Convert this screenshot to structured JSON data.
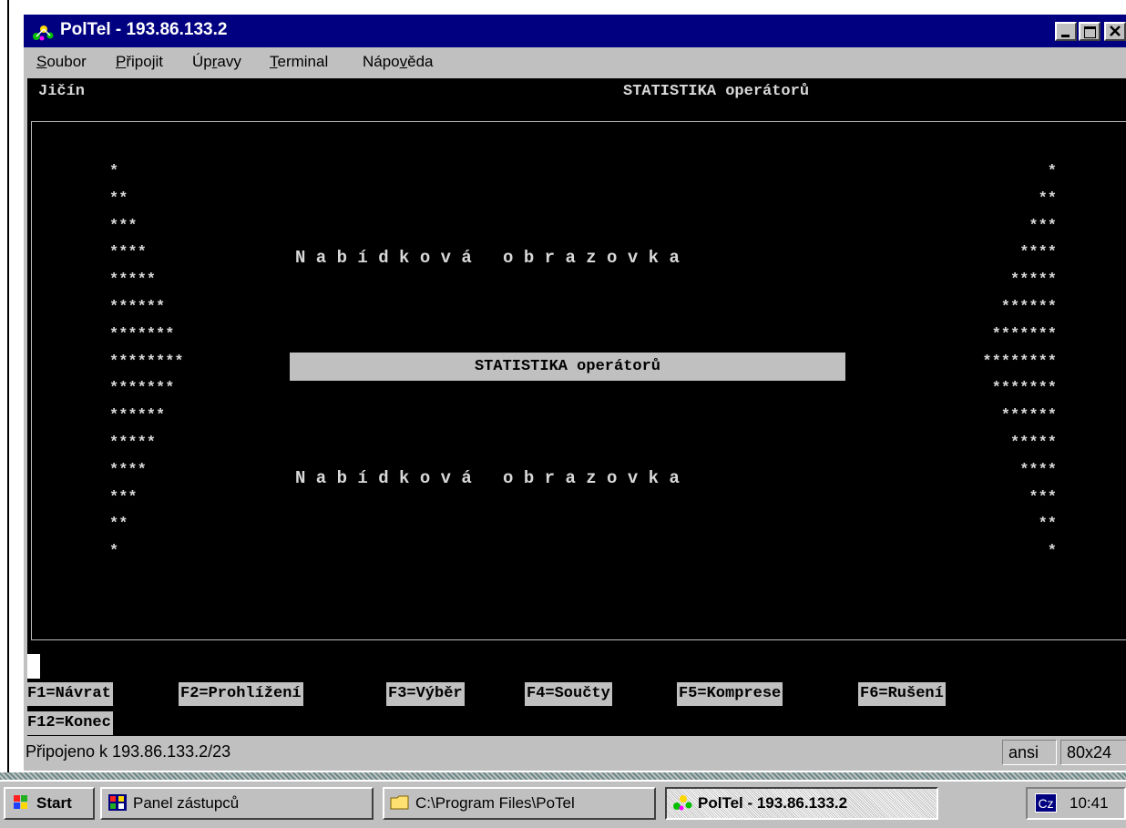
{
  "window": {
    "title": "PolTel - 193.86.133.2"
  },
  "menu": {
    "items": [
      {
        "pre": "",
        "ul": "S",
        "post": "oubor"
      },
      {
        "pre": "",
        "ul": "P",
        "post": "řipojit"
      },
      {
        "pre": "Úp",
        "ul": "r",
        "post": "avy"
      },
      {
        "pre": "",
        "ul": "T",
        "post": "erminal"
      },
      {
        "pre": "Nápo",
        "ul": "v",
        "post": "ěda"
      }
    ]
  },
  "terminal": {
    "location": "Jičín",
    "screen_title": "STATISTIKA operátorů",
    "menu_heading": "N a b í d k o v á   o b r a z o v k a",
    "selected_item": "STATISTIKA operátorů",
    "stars": [
      "*",
      "**",
      "***",
      "****",
      "*****",
      "******",
      "*******",
      "********",
      "*******",
      "******",
      "*****",
      "****",
      "***",
      "**",
      "*"
    ],
    "fkeys": [
      "F1=Návrat",
      "F2=Prohlížení",
      "F3=Výběr",
      "F4=Součty",
      "F5=Komprese",
      "F6=Rušení",
      "F12=Konec"
    ]
  },
  "status": {
    "connection": "Připojeno k 193.86.133.2/23",
    "encoding": "ansi",
    "size": "80x24"
  },
  "taskbar": {
    "start": "Start",
    "buttons": [
      "Panel zástupců",
      "C:\\Program Files\\PoTel",
      "PolTel - 193.86.133.2"
    ],
    "language": "Cz",
    "clock": "10:41"
  }
}
